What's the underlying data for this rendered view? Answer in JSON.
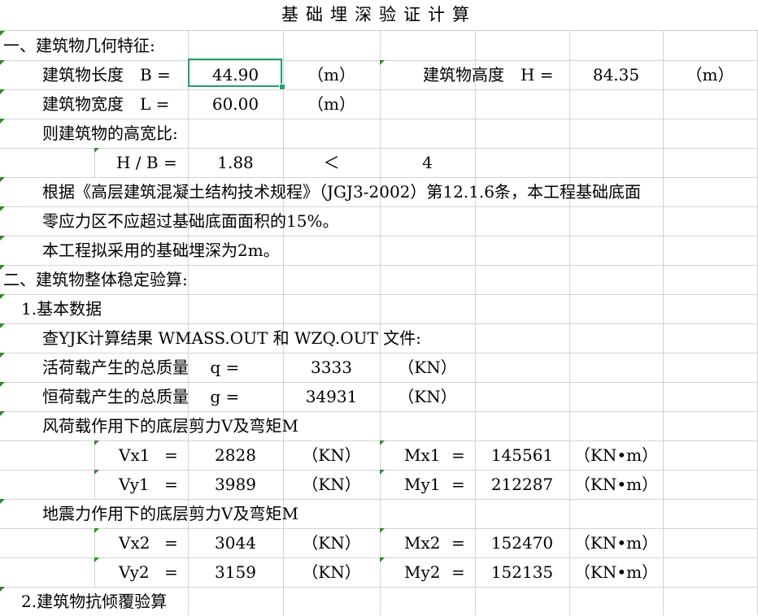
{
  "title": "基础埋深验证计算",
  "section1": {
    "heading": "一、建筑物几何特征:",
    "length_label": "建筑物长度　B =",
    "length_value": "44.90",
    "unit_m": "（m）",
    "height_label": "建筑物高度　H =",
    "height_value": "84.35",
    "width_label": "建筑物宽度　L =",
    "width_value": "60.00",
    "ratio_intro": "则建筑物的高宽比:",
    "ratio_label": "H / B =",
    "ratio_value": "1.88",
    "ratio_compare": "＜",
    "ratio_limit": "4",
    "note1": "根据《高层建筑混凝土结构技术规程》（JGJ3-2002）第12.1.6条，本工程基础底面",
    "note2": "零应力区不应超过基础底面面积的15%。",
    "note3": "本工程拟采用的基础埋深为2m。"
  },
  "section2": {
    "heading": "二、建筑物整体稳定验算:",
    "sub1": "1.基本数据",
    "lookup": "查YJK计算结果 WMASS.OUT 和 WZQ.OUT 文件:",
    "live_label": "活荷载产生的总质量　 q =",
    "live_value": "3333",
    "dead_label": "恒荷载产生的总质量　 g =",
    "dead_value": "34931",
    "unit_kn": "（KN）",
    "unit_knm": "（KN•m）",
    "eq": "=",
    "wind_heading": "风荷载作用下的底层剪力V及弯矩M",
    "seismic_heading": "地震力作用下的底层剪力V及弯矩M",
    "vx1": "Vx1",
    "vx1_value": "2828",
    "mx1": "Mx1",
    "mx1_value": "145561",
    "vy1": "Vy1",
    "vy1_value": "3989",
    "my1": "My1",
    "my1_value": "212287",
    "vx2": "Vx2",
    "vx2_value": "3044",
    "mx2": "Mx2",
    "mx2_value": "152470",
    "vy2": "Vy2",
    "vy2_value": "3159",
    "my2": "My2",
    "my2_value": "152135",
    "sub2": "2.建筑物抗倾覆验算"
  }
}
